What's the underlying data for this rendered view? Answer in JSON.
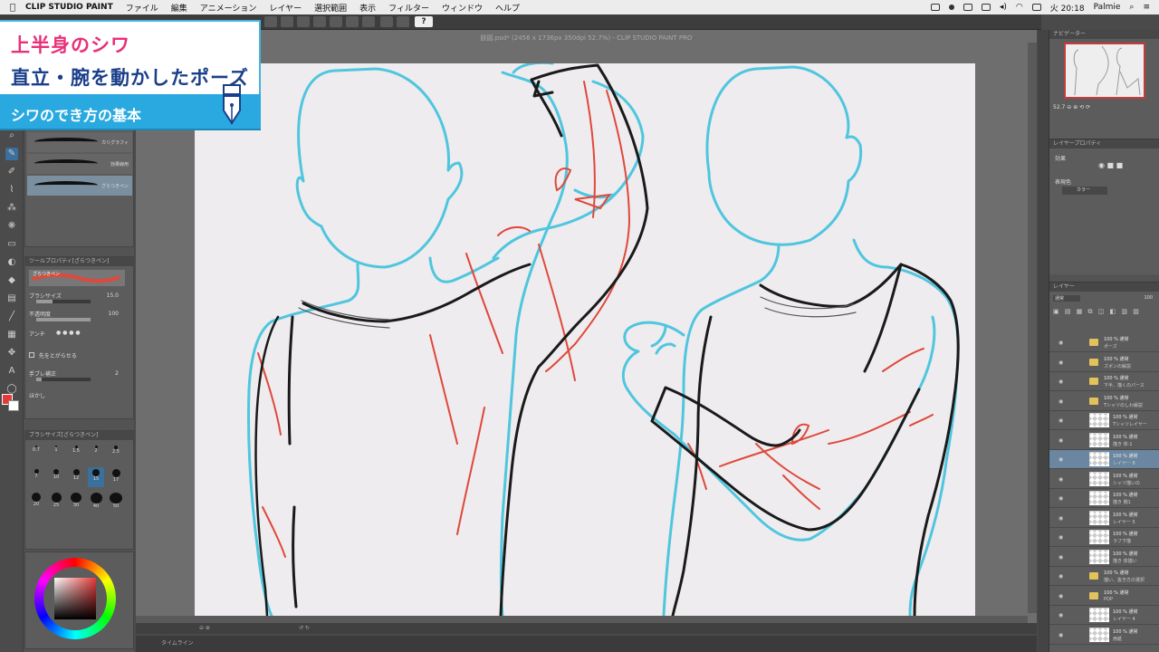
{
  "menubar": {
    "app_name": "CLIP STUDIO PAINT",
    "items": [
      "ファイル",
      "編集",
      "アニメーション",
      "レイヤー",
      "選択範囲",
      "表示",
      "フィルター",
      "ウィンドウ",
      "ヘルプ"
    ],
    "clock": "火 20:18",
    "user": "Palmie"
  },
  "document": {
    "title": "肢図.psd* (2456 x 1736px 350dpi 52.7%) - CLIP STUDIO PAINT PRO"
  },
  "overlay": {
    "title_line1": "上半身のシワ",
    "title_line2": "直立・腕を動かしたポーズ",
    "subtitle": "シワのでき方の基本"
  },
  "colors": {
    "accent_pink": "#e8307a",
    "accent_blue": "#2aa9e0",
    "title_navy": "#1a3f8a",
    "sketch_cyan": "#4fc6de",
    "sketch_red": "#e0483a"
  },
  "sub_tool_panel": {
    "items": [
      "カリグラフィ",
      "効果線用",
      "ざらつきペン"
    ]
  },
  "tool_property": {
    "header": "ツールプロパティ[ざらつきペン]",
    "brush_name": "ざらつきペン",
    "brush_size_label": "ブラシサイズ",
    "brush_size_value": "15.0",
    "density_label": "不透明度",
    "density_value": "100",
    "antialias_label": "アンチ",
    "tip_label": "先をとがらせる",
    "stabilize_label": "手ブレ補正",
    "stabilize_value": "2",
    "thickness_label": "ほかし"
  },
  "brush_size_panel": {
    "header": "ブラシサイズ[ざらつきペン]",
    "row1": [
      "0.7",
      "1",
      "1.5",
      "2",
      "2.5"
    ],
    "row2": [
      "7",
      "10",
      "12",
      "15",
      "17"
    ],
    "row3": [
      "20",
      "25",
      "30",
      "40",
      "50"
    ],
    "selected": "15"
  },
  "navigator": {
    "header": "ナビゲーター",
    "zoom": "52.7"
  },
  "layer_property": {
    "header": "レイヤープロパティ",
    "effect_label": "効果",
    "express_label": "表現色",
    "express_value": "カラー"
  },
  "layers": {
    "header": "レイヤー",
    "blend_mode": "通常",
    "opacity": "100",
    "rows": [
      {
        "l1": "100 % 通常",
        "l2": "ポーズ",
        "type": "folder"
      },
      {
        "l1": "100 % 通常",
        "l2": "ズボンの解説",
        "type": "folder"
      },
      {
        "l1": "100 % 通常",
        "l2": "下半、描くのパース",
        "type": "folder"
      },
      {
        "l1": "100 % 通常",
        "l2": "Tシャツのしわ解説",
        "type": "folder"
      },
      {
        "l1": "100 % 通常",
        "l2": "Tシャツレイヤー",
        "type": "layer"
      },
      {
        "l1": "100 % 通常",
        "l2": "描き 体-1",
        "type": "layer"
      },
      {
        "l1": "100 % 通常",
        "l2": "レイヤー 8",
        "type": "layer",
        "selected": true
      },
      {
        "l1": "100 % 通常",
        "l2": "シャツ描いの",
        "type": "layer"
      },
      {
        "l1": "100 % 通常",
        "l2": "描き 腕1",
        "type": "layer"
      },
      {
        "l1": "100 % 通常",
        "l2": "レイヤー 5",
        "type": "layer"
      },
      {
        "l1": "100 % 通常",
        "l2": "ラフ下描",
        "type": "layer"
      },
      {
        "l1": "100 % 通常",
        "l2": "描き 体描い",
        "type": "layer"
      },
      {
        "l1": "100 % 通常",
        "l2": "描い、抜き方の選択",
        "type": "folder"
      },
      {
        "l1": "100 % 通常",
        "l2": "POP",
        "type": "folder"
      },
      {
        "l1": "100 % 通常",
        "l2": "レイヤー 4",
        "type": "layer"
      },
      {
        "l1": "100 % 通常",
        "l2": "用紙",
        "type": "layer"
      }
    ]
  },
  "timeline": {
    "label": "タイムライン"
  }
}
